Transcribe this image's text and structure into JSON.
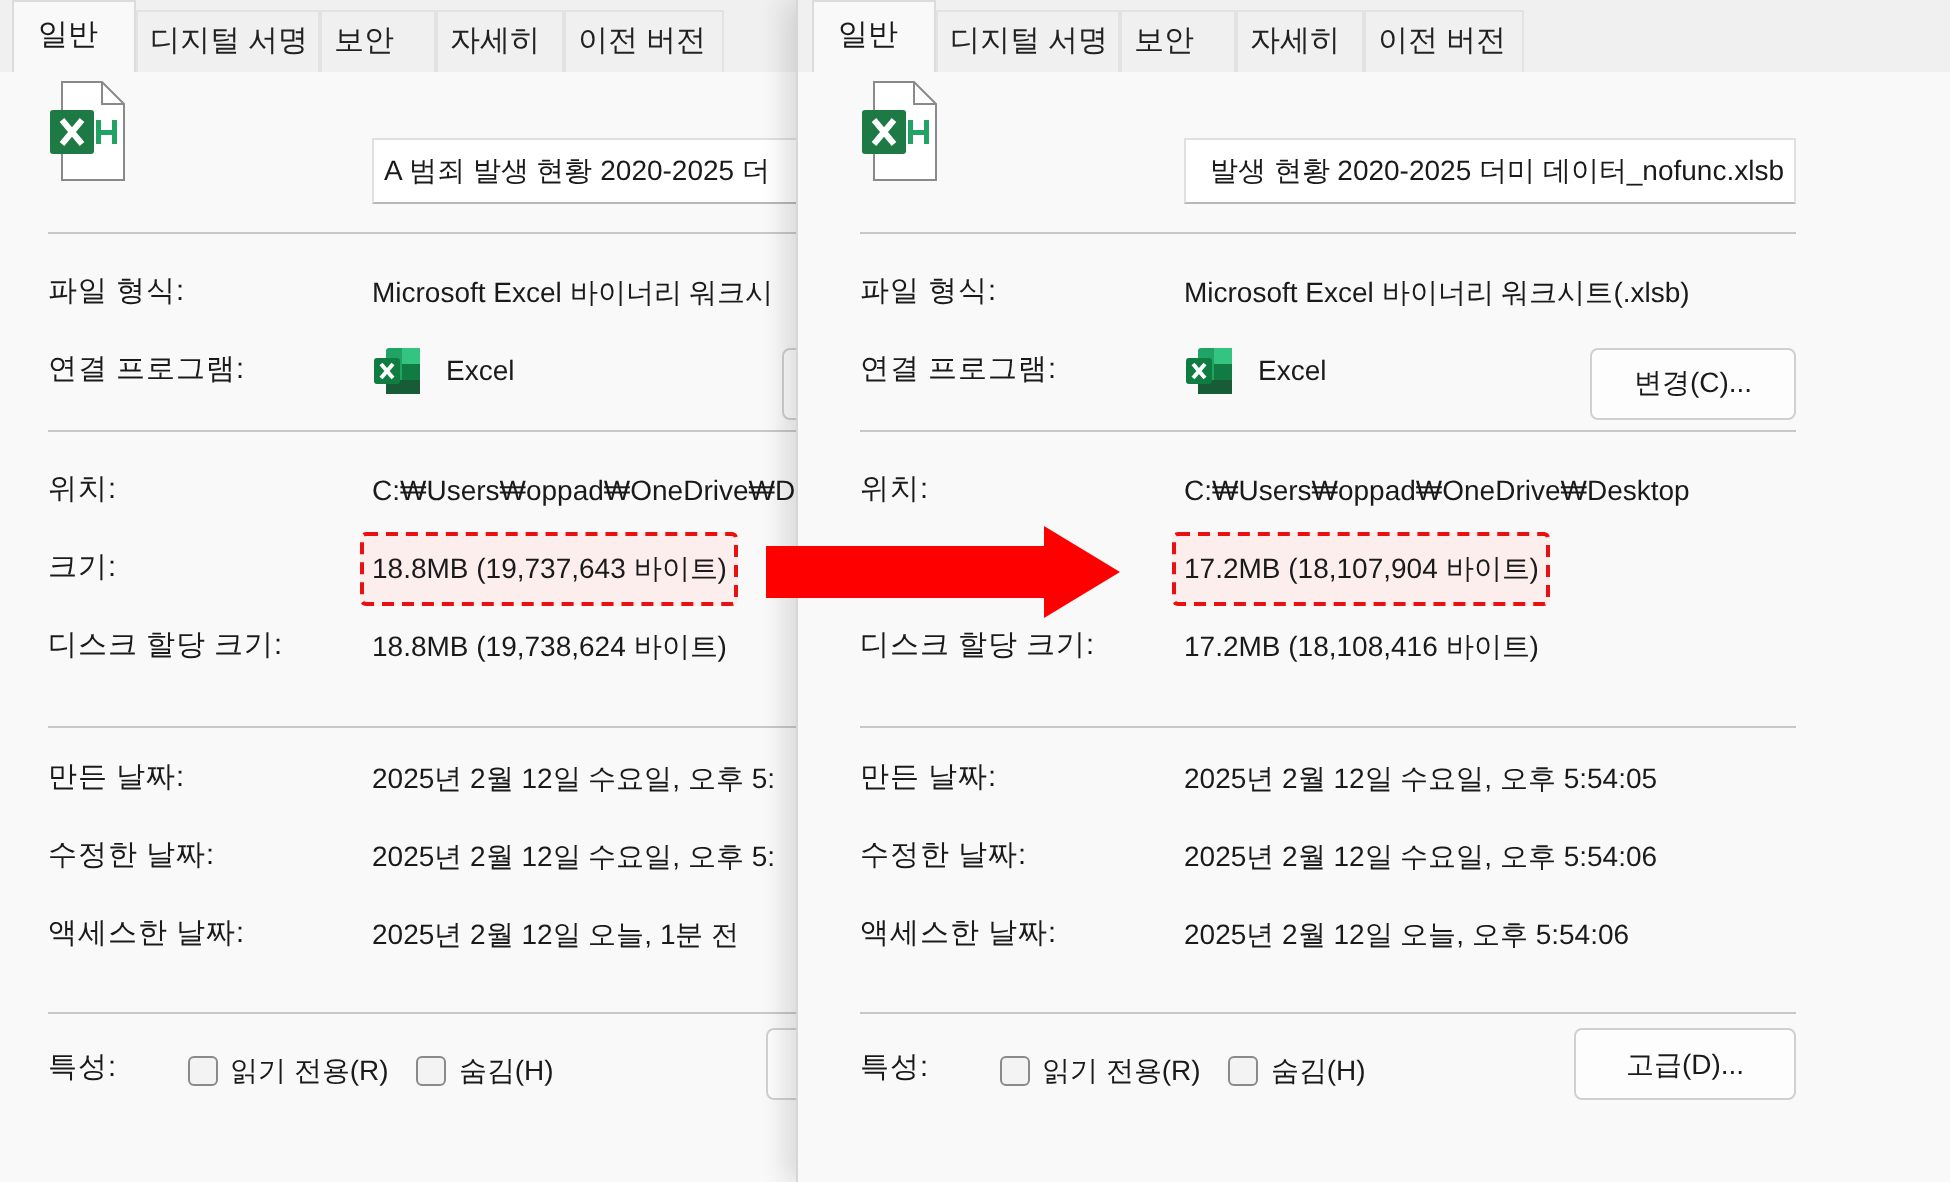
{
  "dialogs": [
    {
      "tabs": [
        {
          "label": "일반",
          "selected": true
        },
        {
          "label": "디지털 서명",
          "selected": false
        },
        {
          "label": "보안",
          "selected": false
        },
        {
          "label": "자세히",
          "selected": false
        },
        {
          "label": "이전 버전",
          "selected": false
        }
      ],
      "file_name": {
        "value": "A 범죄 발생 현황 2020-2025 더",
        "scrolled_to_end": false
      },
      "sections": [
        [
          {
            "kind": "text",
            "label": "파일 형식:",
            "value": "Microsoft Excel 바이너리 워크시"
          },
          {
            "kind": "program",
            "label": "연결 프로그램:",
            "value": "Excel",
            "button_edge": true
          }
        ],
        [
          {
            "kind": "text",
            "label": "위치:",
            "value": "C:₩Users₩oppad₩OneDrive₩D"
          },
          {
            "kind": "text",
            "label": "크기:",
            "value": "18.8MB (19,737,643 바이트)",
            "highlighted": true
          },
          {
            "kind": "text",
            "label": "디스크 할당 크기:",
            "value": "18.8MB (19,738,624 바이트)"
          }
        ],
        [
          {
            "kind": "text",
            "label": "만든 날짜:",
            "value": "2025년 2월 12일 수요일, 오후 5:"
          },
          {
            "kind": "text",
            "label": "수정한 날짜:",
            "value": "2025년 2월 12일 수요일, 오후 5:"
          },
          {
            "kind": "text",
            "label": "액세스한 날짜:",
            "value": "2025년 2월 12일 오늘, 1분 전"
          }
        ]
      ],
      "attributes": {
        "label": "특성:",
        "checkboxes": [
          {
            "label": "읽기 전용(R)",
            "checked": false
          },
          {
            "label": "숨김(H)",
            "checked": false
          }
        ],
        "button_edge": true
      }
    },
    {
      "tabs": [
        {
          "label": "일반",
          "selected": true
        },
        {
          "label": "디지털 서명",
          "selected": false
        },
        {
          "label": "보안",
          "selected": false
        },
        {
          "label": "자세히",
          "selected": false
        },
        {
          "label": "이전 버전",
          "selected": false
        }
      ],
      "file_name": {
        "value": "발생 현황 2020-2025 더미 데이터_nofunc.xlsb",
        "scrolled_to_end": true
      },
      "sections": [
        [
          {
            "kind": "text",
            "label": "파일 형식:",
            "value": "Microsoft Excel 바이너리 워크시트(.xlsb)"
          },
          {
            "kind": "program",
            "label": "연결 프로그램:",
            "value": "Excel",
            "button": "변경(C)..."
          }
        ],
        [
          {
            "kind": "text",
            "label": "위치:",
            "value": "C:₩Users₩oppad₩OneDrive₩Desktop"
          },
          {
            "kind": "text",
            "value": "17.2MB (18,107,904 바이트)",
            "highlighted": true
          },
          {
            "kind": "text",
            "label": "디스크 할당 크기:",
            "value": "17.2MB (18,108,416 바이트)"
          }
        ],
        [
          {
            "kind": "text",
            "label": "만든 날짜:",
            "value": "2025년 2월 12일 수요일, 오후 5:54:05"
          },
          {
            "kind": "text",
            "label": "수정한 날짜:",
            "value": "2025년 2월 12일 수요일, 오후 5:54:06"
          },
          {
            "kind": "text",
            "label": "액세스한 날짜:",
            "value": "2025년 2월 12일 오늘, 오후 5:54:06"
          }
        ]
      ],
      "attributes": {
        "label": "특성:",
        "checkboxes": [
          {
            "label": "읽기 전용(R)",
            "checked": false
          },
          {
            "label": "숨김(H)",
            "checked": false
          }
        ],
        "button": "고급(D)..."
      }
    }
  ]
}
